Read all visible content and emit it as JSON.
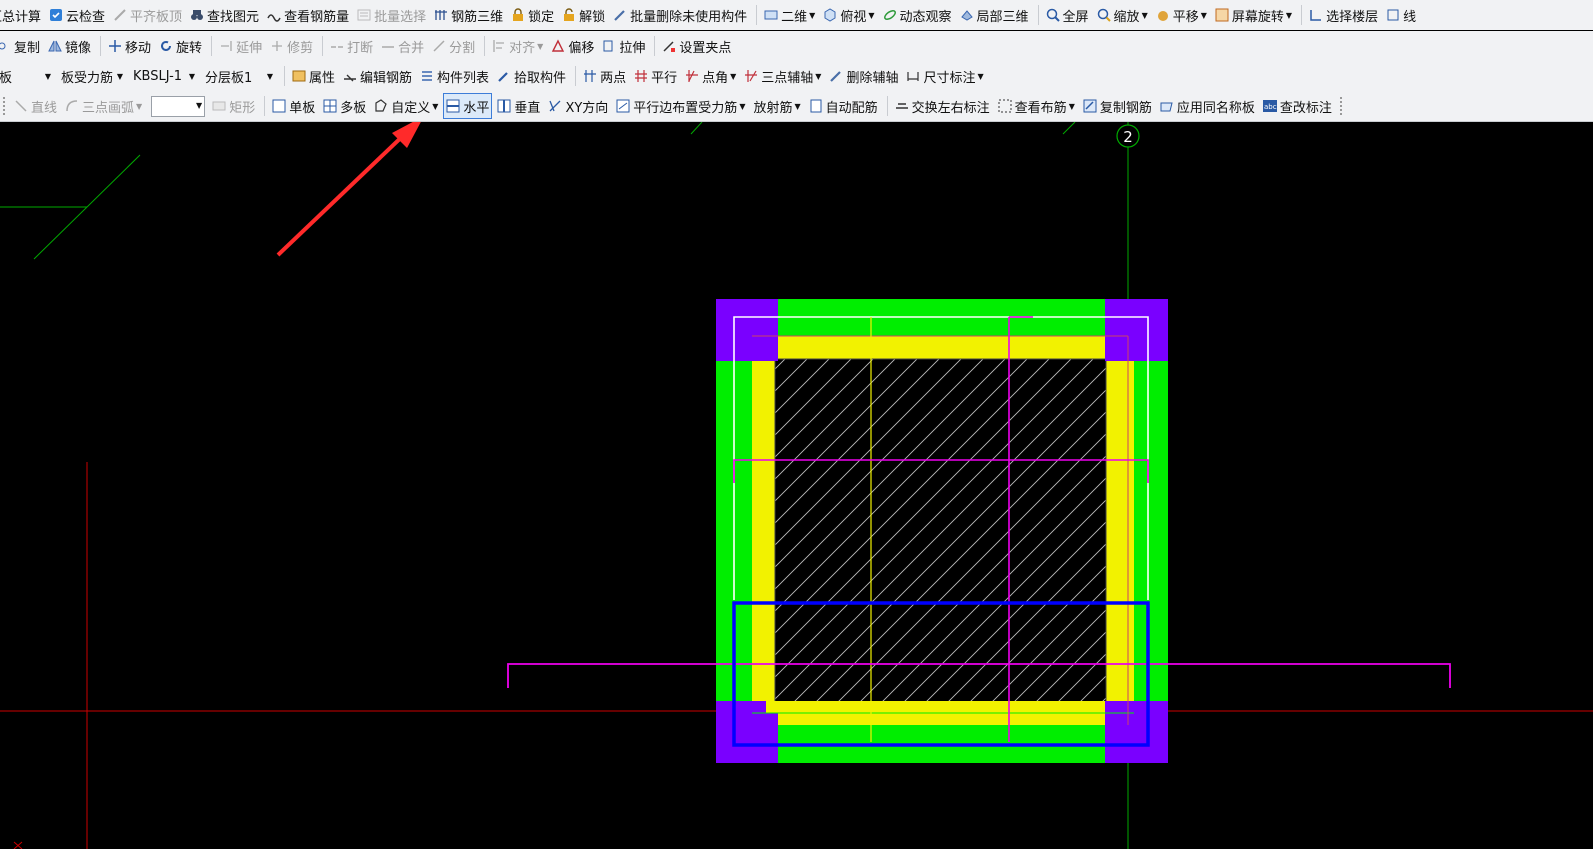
{
  "toolbar1": {
    "items": [
      "汇总计算",
      "云检查",
      "平齐板顶",
      "查找图元",
      "查看钢筋量",
      "批量选择",
      "钢筋三维",
      "锁定",
      "解锁",
      "批量删除未使用构件",
      "二维",
      "俯视",
      "动态观察",
      "局部三维",
      "全屏",
      "缩放",
      "平移",
      "屏幕旋转",
      "选择楼层",
      "线"
    ]
  },
  "toolbar2": {
    "items": [
      "复制",
      "镜像",
      "移动",
      "旋转",
      "延伸",
      "修剪",
      "打断",
      "合并",
      "分割",
      "对齐",
      "偏移",
      "拉伸",
      "设置夹点"
    ]
  },
  "toolbar3": {
    "combo_type": "板",
    "combo_rebar": "板受力筋",
    "combo_name": "KBSLJ-1",
    "combo_layer": "分层板1",
    "items": [
      "属性",
      "编辑钢筋",
      "构件列表",
      "拾取构件",
      "两点",
      "平行",
      "点角",
      "三点辅轴",
      "删除辅轴",
      "尺寸标注"
    ]
  },
  "toolbar4": {
    "items": [
      "直线",
      "三点画弧",
      "矩形",
      "单板",
      "多板",
      "自定义",
      "水平",
      "垂直",
      "XY方向",
      "平行边布置受力筋",
      "放射筋",
      "自动配筋",
      "交换左右标注",
      "查看布筋",
      "复制钢筋",
      "应用同名称板",
      "查改标注"
    ]
  },
  "canvas": {
    "axis_label": "2",
    "colors": {
      "background": "#000000",
      "column_corner": "#7a00ff",
      "beam": "#00ee00",
      "inner_band": "#f2f200",
      "rebar_magenta": "#ee00ee",
      "rebar_selected": "#0000ff",
      "axis_green": "#00aa00",
      "axis_red": "#cc0000",
      "arrow": "#ff2a2a"
    }
  }
}
